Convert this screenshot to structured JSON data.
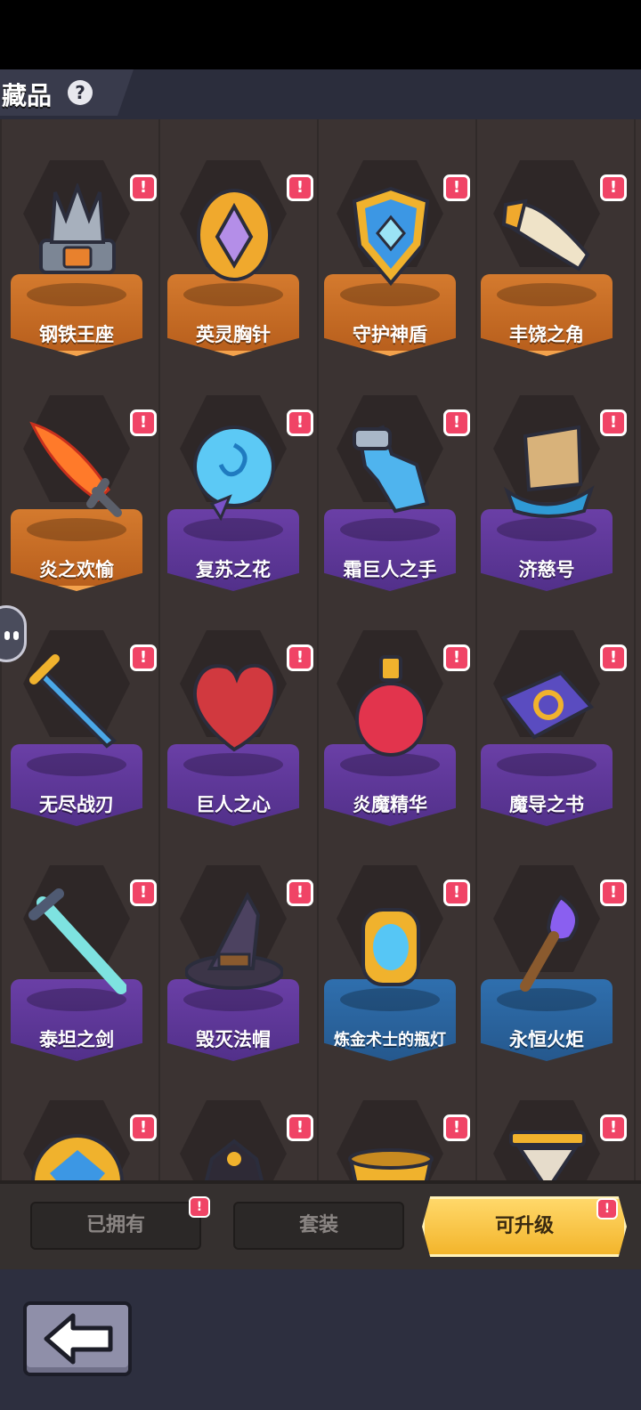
{
  "header": {
    "title": "藏品",
    "help_icon": "?"
  },
  "items": [
    {
      "label": "钢铁王座",
      "tier": "orange",
      "icon": "iron-throne-icon",
      "badge": "!"
    },
    {
      "label": "英灵胸针",
      "tier": "orange",
      "icon": "brooch-icon",
      "badge": "!"
    },
    {
      "label": "守护神盾",
      "tier": "orange",
      "icon": "shield-icon",
      "badge": "!"
    },
    {
      "label": "丰饶之角",
      "tier": "orange",
      "icon": "horn-icon",
      "badge": "!"
    },
    {
      "label": "炎之欢愉",
      "tier": "orange",
      "icon": "flame-sword-icon",
      "badge": "!"
    },
    {
      "label": "复苏之花",
      "tier": "purple",
      "icon": "blue-rose-icon",
      "badge": "!"
    },
    {
      "label": "霜巨人之手",
      "tier": "purple",
      "icon": "frost-hand-icon",
      "badge": "!"
    },
    {
      "label": "济慈号",
      "tier": "purple",
      "icon": "ship-icon",
      "badge": "!"
    },
    {
      "label": "无尽战刃",
      "tier": "purple",
      "icon": "golden-sword-icon",
      "badge": "!"
    },
    {
      "label": "巨人之心",
      "tier": "purple",
      "icon": "heart-icon",
      "badge": "!"
    },
    {
      "label": "炎魔精华",
      "tier": "purple",
      "icon": "potion-icon",
      "badge": "!"
    },
    {
      "label": "魔导之书",
      "tier": "purple",
      "icon": "spellbook-icon",
      "badge": "!"
    },
    {
      "label": "泰坦之剑",
      "tier": "purple",
      "icon": "titan-sword-icon",
      "badge": "!"
    },
    {
      "label": "毁灭法帽",
      "tier": "purple",
      "icon": "witch-hat-icon",
      "badge": "!"
    },
    {
      "label": "炼金术士的瓶灯",
      "tier": "blue",
      "icon": "lantern-icon",
      "badge": "!"
    },
    {
      "label": "永恒火炬",
      "tier": "blue",
      "icon": "torch-icon",
      "badge": "!"
    },
    {
      "label": "",
      "tier": "blue",
      "icon": "gem-crest-icon",
      "badge": "!"
    },
    {
      "label": "",
      "tier": "blue",
      "icon": "cloak-icon",
      "badge": "!"
    },
    {
      "label": "",
      "tier": "blue",
      "icon": "golden-cup-icon",
      "badge": "!"
    },
    {
      "label": "",
      "tier": "blue",
      "icon": "hourglass-icon",
      "badge": "!"
    }
  ],
  "tabs": [
    {
      "label": "已拥有",
      "active": false,
      "badge": "!"
    },
    {
      "label": "套装",
      "active": false,
      "badge": ""
    },
    {
      "label": "可升级",
      "active": true,
      "badge": "!"
    }
  ],
  "footer": {
    "back_icon": "arrow-left-icon"
  }
}
